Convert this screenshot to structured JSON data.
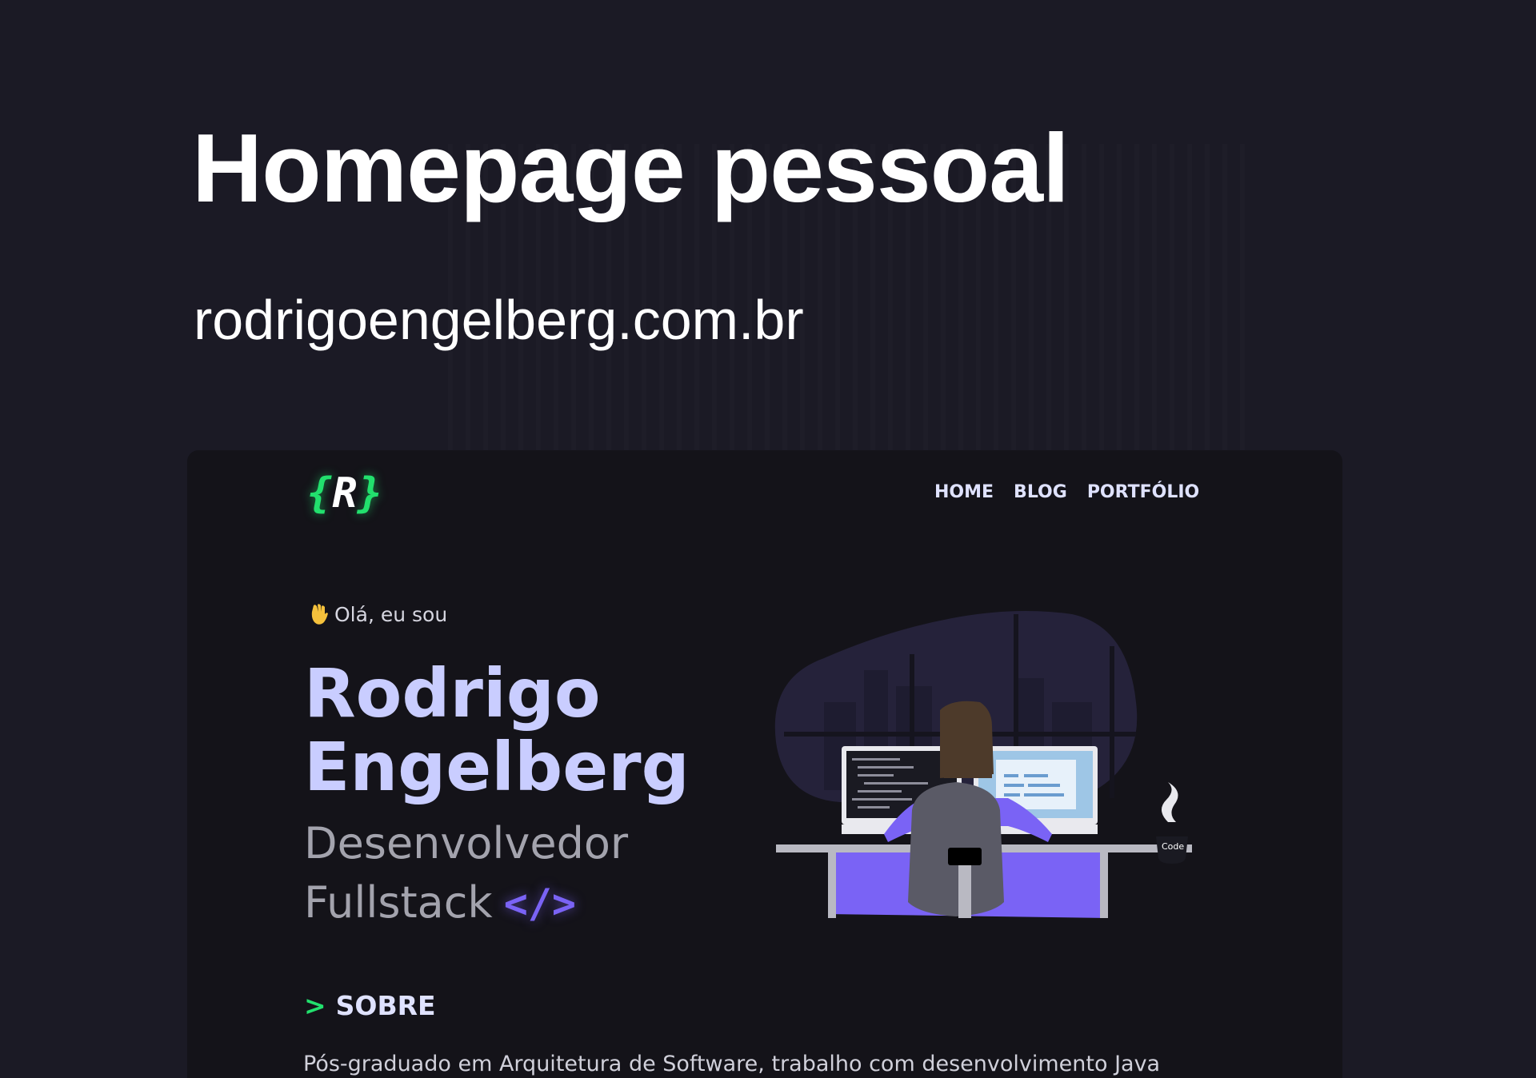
{
  "slide": {
    "title": "Homepage pessoal",
    "url": "rodrigoengelberg.com.br"
  },
  "site": {
    "logo": {
      "open": "{",
      "letter": "R",
      "close": "}"
    },
    "nav": [
      {
        "label": "HOME"
      },
      {
        "label": "BLOG"
      },
      {
        "label": "PORTFÓLIO"
      }
    ],
    "hero": {
      "greeting": "Olá, eu sou",
      "greeting_icon": "waving-hand-icon",
      "name_line1": "Rodrigo",
      "name_line2": "Engelberg",
      "role_line1": "Desenvolvedor",
      "role_line2": "Fullstack",
      "code_tag": "</>",
      "mug_label": "Code"
    },
    "about": {
      "prompt": ">",
      "heading": "SOBRE",
      "text": "Pós-graduado em Arquitetura de Software, trabalho com desenvolvimento Java"
    },
    "colors": {
      "accent_green": "#22e06d",
      "accent_purple": "#7a63f5",
      "name_color": "#c9cdff",
      "background": "#141319"
    }
  }
}
